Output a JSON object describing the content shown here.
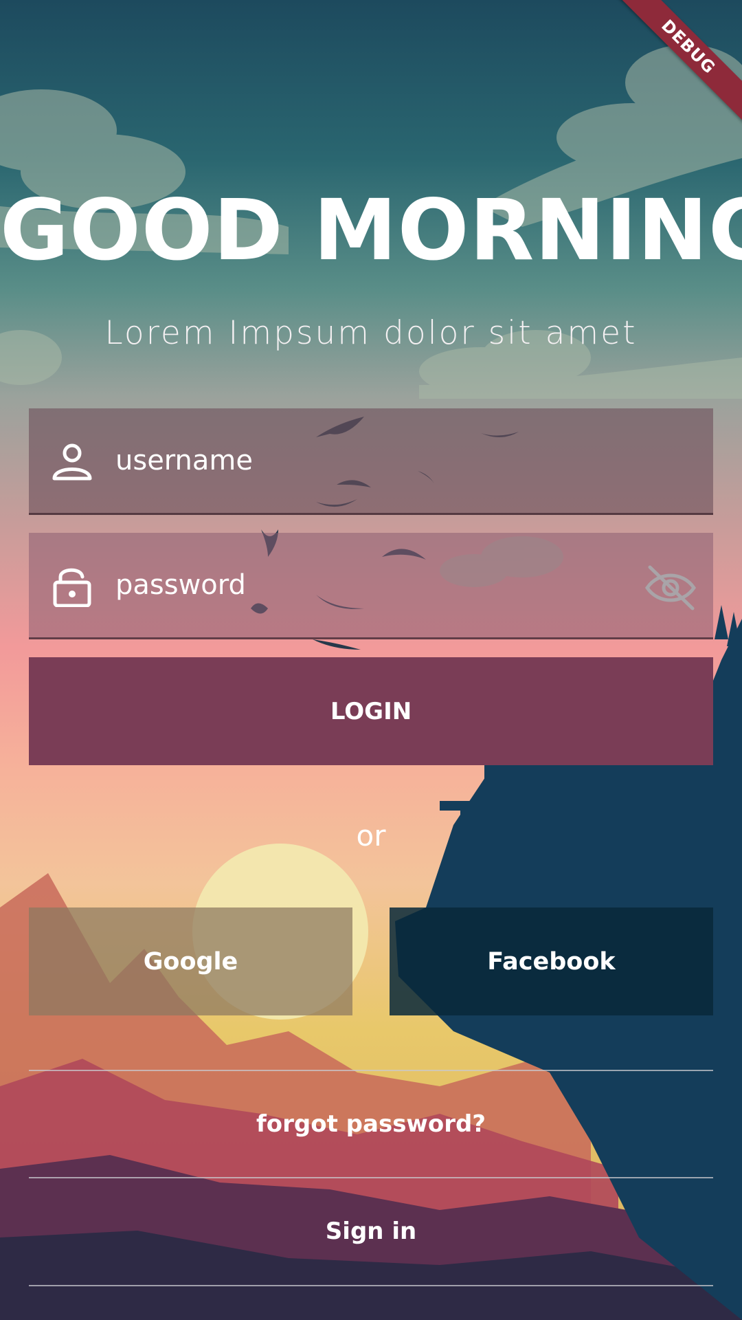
{
  "debug_banner": "DEBUG",
  "header": {
    "title": "GOOD MORNING",
    "subtitle": "Lorem Impsum dolor sit amet"
  },
  "form": {
    "username": {
      "placeholder": "username",
      "icon": "person-outline-icon"
    },
    "password": {
      "placeholder": "password",
      "icon": "lock-open-icon",
      "toggle_icon": "visibility-off-icon"
    }
  },
  "actions": {
    "login_label": "LOGIN",
    "or_label": "or",
    "google_label": "Google",
    "facebook_label": "Facebook",
    "forgot_label": "forgot password?",
    "signin_label": "Sign in"
  },
  "colors": {
    "login_button": "#7a3d56",
    "debug_ribbon": "#8e2a3a",
    "facebook_button": "#08283a"
  }
}
